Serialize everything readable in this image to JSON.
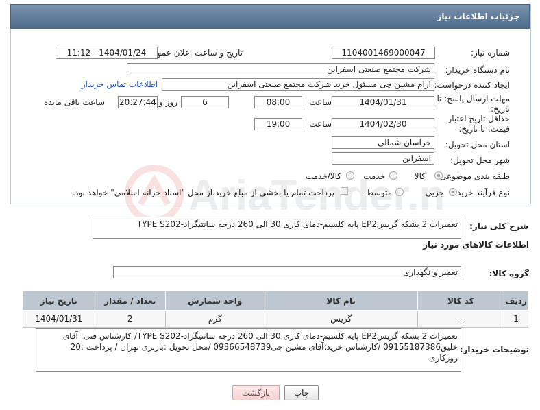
{
  "header": {
    "title": "جزئیات اطلاعات نیاز"
  },
  "labels": {
    "need_number": "شماره نیاز:",
    "announce_datetime": "تاریخ و ساعت اعلان عمومی:",
    "buyer_org": "نام دستگاه خریدار:",
    "requester": "ایجاد کننده درخواست:",
    "buyer_contact_link": "اطلاعات تماس خریدار",
    "reply_deadline": "مهلت ارسال پاسخ: تا تاریخ:",
    "hour": "ساعت",
    "day_and": "روز و",
    "time_remaining": "ساعت باقی مانده",
    "price_validity": "حداقل تاریخ اعتبار قیمت: تا تاریخ:",
    "delivery_province": "استان محل تحویل:",
    "delivery_city": "شهر محل تحویل:",
    "subject_class": "طبقه بندی موضوعی:",
    "purchase_type": "نوع فرآیند خرید :",
    "general_desc": "شرح کلی نیاز:",
    "goods_info": "اطلاعات کالاهای مورد نیاز",
    "goods_group": "گروه کالا:",
    "buyer_notes": "توضیحات خریدار:"
  },
  "fields": {
    "need_number": "1104001469000047",
    "announce_datetime": "1404/01/24 - 11:12",
    "buyer_org": "شرکت مجتمع صنعتی اسفراین",
    "requester": "آرام مشین چی مسئول خرید شرکت مجتمع صنعتی اسفراین",
    "reply_date": "1404/01/31",
    "reply_time": "08:00",
    "days": "6",
    "remaining": "20:27:44",
    "validity_date": "1404/02/30",
    "validity_time": "19:00",
    "province": "خراسان شمالی",
    "city": "اسفراین",
    "general_desc": "تعمیرات 2 بشکه گریسEP2 پایه کلسیم-دمای کاری 30 الی 260 درجه سانتیگراد-TYPE S202",
    "goods_group": "تعمیر و نگهداری",
    "buyer_notes": "تعمیرات 2 بشکه گریسEP2 پایه کلسیم-دمای کاری 30 الی 260 درجه سانتیگراد-TYPE S202/ کارشناس فنی: آقای خلیق09155187386 /کارشناس خرید:آقای مشین چی09366548739 /محل تحویل :باربری تهران / پرداخت :20 روزکاری"
  },
  "subject_options": {
    "goods": "کالا",
    "service": "خدمت",
    "goods_service": "کالا/خدمت",
    "selected": "کالا"
  },
  "purchase_options": {
    "minor": "جزیی",
    "medium": "متوسط",
    "treasury_note": "پرداخت تمام یا بخشی از مبلغ خرید،از محل \"اسناد خزانه اسلامی\" خواهد بود.",
    "selected": "جزیی"
  },
  "table": {
    "headers": [
      "ردیف",
      "کد کالا",
      "نام کالا",
      "واحد شمارش",
      "تعداد / مقدار",
      "تاریخ نیاز"
    ],
    "rows": [
      [
        "1",
        "--",
        "گریس",
        "گرم",
        "2",
        "1404/01/31"
      ]
    ]
  },
  "buttons": {
    "print": "چاپ",
    "back": "بازگشت"
  },
  "watermark": {
    "text": "AriaTender.neT"
  },
  "colors": {
    "header": "#5a7696",
    "link": "#1a56c8",
    "table_header": "#bdc7d2",
    "back_button": "#f6cfd2"
  }
}
